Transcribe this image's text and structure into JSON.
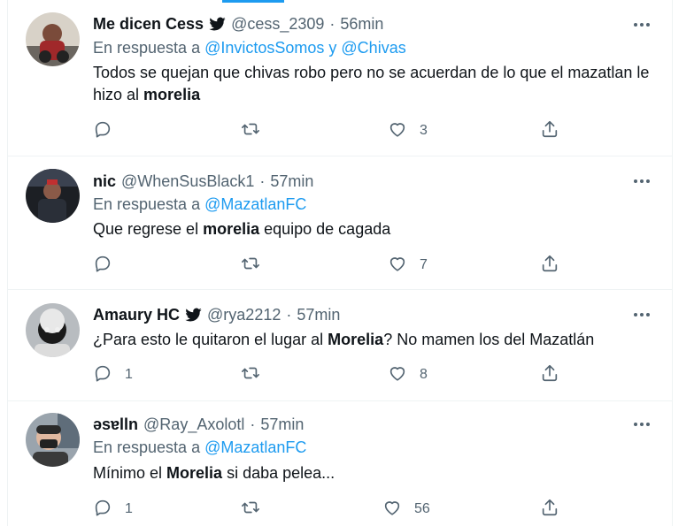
{
  "tweets": [
    {
      "name": "Me dicen Cess",
      "verified": true,
      "handle": "@cess_2309",
      "separator": "·",
      "time": "56min",
      "reply_prefix": "En respuesta a",
      "reply_targets": "@InvictosSomos y @Chivas",
      "text_before": "Todos se quejan que chivas robo pero no se acuerdan de lo que el mazatlan le hizo al ",
      "text_bold": "morelia",
      "text_after": "",
      "replies": "",
      "retweets": "",
      "likes": "3"
    },
    {
      "name": "nic",
      "verified": false,
      "handle": "@WhenSusBlack1",
      "separator": "·",
      "time": "57min",
      "reply_prefix": "En respuesta a",
      "reply_targets": "@MazatlanFC",
      "text_before": "Que regrese el ",
      "text_bold": "morelia",
      "text_after": " equipo de cagada",
      "replies": "",
      "retweets": "",
      "likes": "7"
    },
    {
      "name": "Amaury HC",
      "verified": true,
      "handle": "@rya2212",
      "separator": "·",
      "time": "57min",
      "text_before": "¿Para esto le quitaron el lugar al ",
      "text_bold": "Morelia",
      "text_after": "? No mamen los del Mazatlán",
      "replies": "1",
      "retweets": "",
      "likes": "8"
    },
    {
      "name": "ǝsɐlln",
      "verified": false,
      "handle": "@Ray_Axolotl",
      "separator": "·",
      "time": "57min",
      "reply_prefix": "En respuesta a",
      "reply_targets": "@MazatlanFC",
      "text_before": "Mínimo el ",
      "text_bold": "Morelia",
      "text_after": " si daba pelea...",
      "replies": "1",
      "retweets": "",
      "likes": "56"
    }
  ],
  "colors": {
    "accent": "#1d9bf0",
    "text": "#0f1419",
    "secondary": "#536471",
    "divider": "#eff3f4"
  },
  "icons": [
    "verified-badge-icon",
    "more-icon",
    "reply-icon",
    "retweet-icon",
    "like-icon",
    "share-icon"
  ]
}
